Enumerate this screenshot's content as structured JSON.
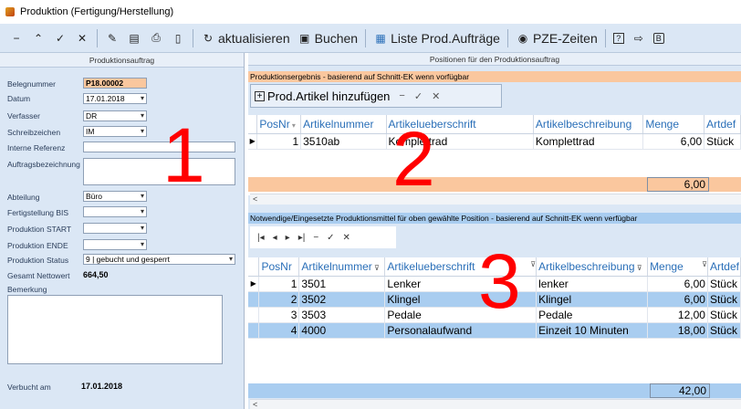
{
  "window": {
    "title": "Produktion (Fertigung/Herstellung)"
  },
  "toolbar": {
    "nav_icons": [
      "minus-icon",
      "chevron-up-icon",
      "check-icon",
      "close-icon"
    ],
    "refresh_label": "aktualisieren",
    "book_label": "Buchen",
    "orders_label": "Liste Prod.Aufträge",
    "pze_label": "PZE-Zeiten"
  },
  "left": {
    "header": "Produktionsauftrag",
    "fields": {
      "belegnummer_label": "Belegnummer",
      "belegnummer_value": "P18.00002",
      "datum_label": "Datum",
      "datum_value": "17.01.2018",
      "verfasser_label": "Verfasser",
      "verfasser_value": "DR",
      "schreibzeichen_label": "Schreibzeichen",
      "schreibzeichen_value": "IM",
      "interne_referenz_label": "Interne Referenz",
      "auftragsbezeichnung_label": "Auftragsbezeichnung",
      "abteilung_label": "Abteilung",
      "abteilung_value": "Büro",
      "fertigstellung_label": "Fertigstellung BIS",
      "start_label": "Produktion START",
      "ende_label": "Produktion ENDE",
      "status_label": "Produktion Status",
      "status_value": "9 | gebucht und gesperrt",
      "netto_label": "Gesamt Nettowert",
      "netto_value": "664,50",
      "bemerkung_label": "Bemerkung",
      "verbucht_label": "Verbucht am",
      "verbucht_value": "17.01.2018"
    }
  },
  "right": {
    "header": "Positionen für den Produktionsauftrag",
    "result_bar": "Produktionsergebnis - basierend auf Schnitt-EK wenn vorfügbar",
    "add_button": "Prod.Artikel hinzufügen",
    "grid1": {
      "columns": [
        "PosNr",
        "Artikelnummer",
        "Artikelueberschrift",
        "Artikelbeschreibung",
        "Menge",
        "Artdef"
      ],
      "rows": [
        [
          "1",
          "3510ab",
          "Komplettrad",
          "Komplettrad",
          "6,00",
          "Stück"
        ]
      ],
      "sum": "6,00"
    },
    "means_bar": "Notwendige/Eingesetzte Produktionsmittel für oben gewählte Position - basierend auf Schnitt-EK wenn verfügbar",
    "grid2": {
      "columns": [
        "PosNr",
        "Artikelnummer",
        "Artikelueberschrift",
        "Artikelbeschreibung",
        "Menge",
        "Artdef"
      ],
      "rows": [
        [
          "1",
          "3501",
          "Lenker",
          "lenker",
          "6,00",
          "Stück"
        ],
        [
          "2",
          "3502",
          "Klingel",
          "Klingel",
          "6,00",
          "Stück"
        ],
        [
          "3",
          "3503",
          "Pedale",
          "Pedale",
          "12,00",
          "Stück"
        ],
        [
          "4",
          "4000",
          "Personalaufwand",
          "Einzeit 10 Minuten",
          "18,00",
          "Stück"
        ]
      ],
      "sum": "42,00"
    }
  },
  "callouts": [
    "1",
    "2",
    "3"
  ],
  "colors": {
    "toolbar_bg": "#dbe7f5",
    "highlight_orange": "#fac79e",
    "row_blue": "#a9cdf0",
    "callout_red": "#ff0000"
  }
}
